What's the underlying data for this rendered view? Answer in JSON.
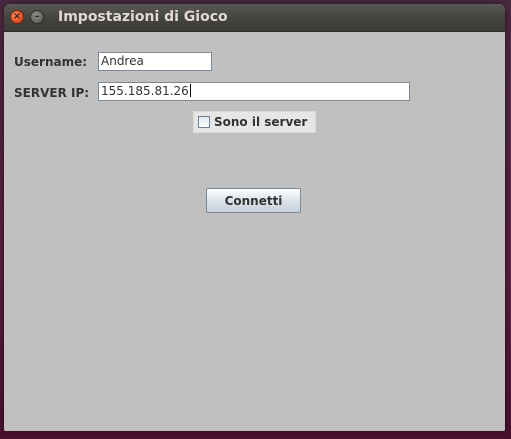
{
  "window": {
    "title": "Impostazioni di Gioco",
    "close_glyph": "×",
    "minimize_glyph": "–"
  },
  "form": {
    "username_label": "Username:",
    "username_value": "Andrea",
    "server_ip_label": "SERVER IP:",
    "server_ip_value": "155.185.81.26",
    "server_checkbox_label": "Sono il server",
    "server_checkbox_checked": false,
    "connect_label": "Connetti"
  },
  "colors": {
    "window_bg": "#c0c0c0",
    "titlebar": "#3c3b37",
    "close_button": "#e5562a"
  },
  "icons": {
    "close": "close-icon",
    "minimize": "minimize-icon"
  }
}
